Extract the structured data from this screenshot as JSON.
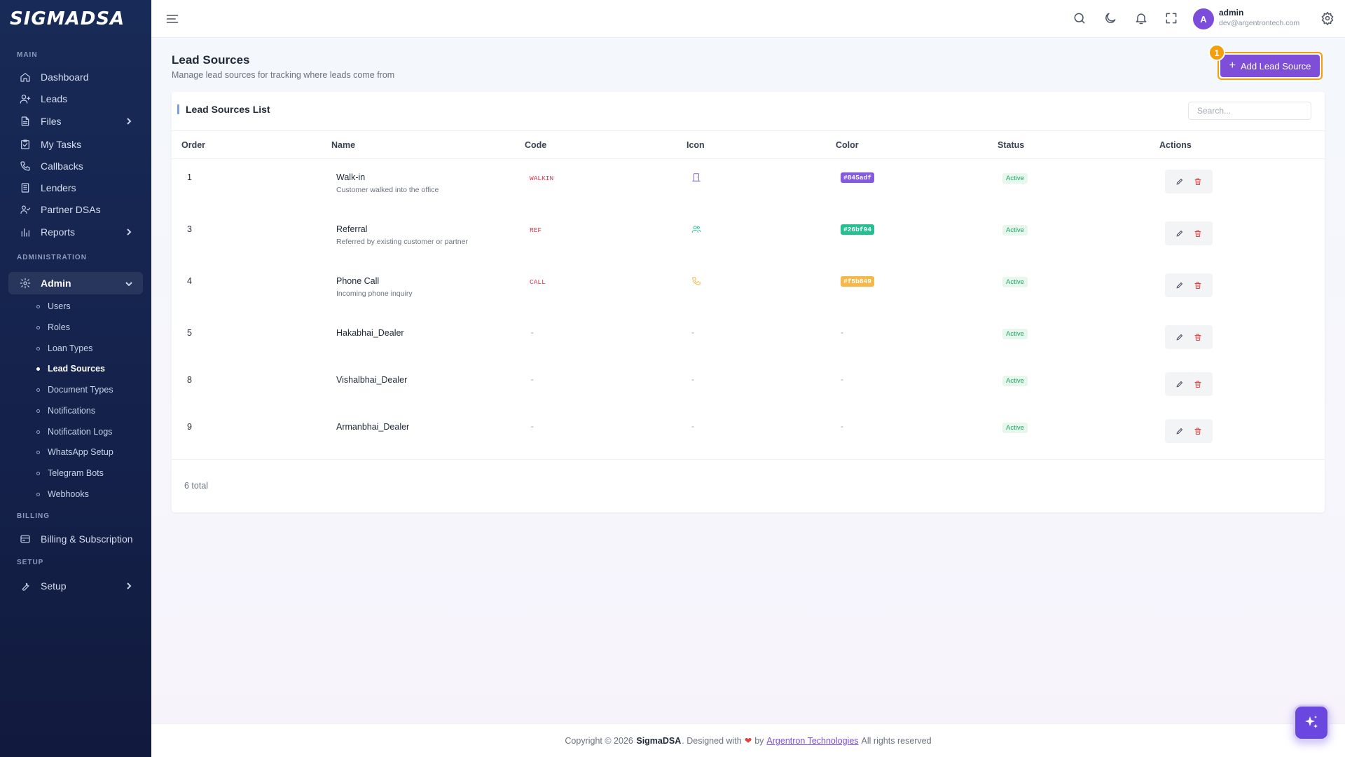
{
  "brand": {
    "logo": "SIGMADSA"
  },
  "sidebar": {
    "sections": {
      "main": "MAIN",
      "administration": "ADMINISTRATION",
      "billing": "BILLING",
      "setup": "SETUP"
    },
    "items": {
      "dashboard": "Dashboard",
      "leads": "Leads",
      "files": "Files",
      "my_tasks": "My Tasks",
      "callbacks": "Callbacks",
      "lenders": "Lenders",
      "partner_dsas": "Partner DSAs",
      "reports": "Reports",
      "admin": "Admin",
      "billing": "Billing & Subscription",
      "setup": "Setup"
    },
    "admin_sub": [
      "Users",
      "Roles",
      "Loan Types",
      "Lead Sources",
      "Document Types",
      "Notifications",
      "Notification Logs",
      "WhatsApp Setup",
      "Telegram Bots",
      "Webhooks"
    ],
    "active_sub": "Lead Sources"
  },
  "user": {
    "avatar_initial": "A",
    "name": "admin",
    "email": "dev@argentrontech.com"
  },
  "page": {
    "title": "Lead Sources",
    "subtitle": "Manage lead sources for tracking where leads come from",
    "add_button": "Add Lead Source",
    "step_badge": "1"
  },
  "card": {
    "title": "Lead Sources List",
    "search_placeholder": "Search...",
    "columns": [
      "Order",
      "Name",
      "Code",
      "Icon",
      "Color",
      "Status",
      "Actions"
    ],
    "rows": [
      {
        "order": "1",
        "name": "Walk-in",
        "description": "Customer walked into the office",
        "code": "WALKIN",
        "icon": "door-icon",
        "color": "#845adf",
        "status": "Active"
      },
      {
        "order": "3",
        "name": "Referral",
        "description": "Referred by existing customer or partner",
        "code": "REF",
        "icon": "users-icon",
        "color": "#26bf94",
        "status": "Active"
      },
      {
        "order": "4",
        "name": "Phone Call",
        "description": "Incoming phone inquiry",
        "code": "CALL",
        "icon": "phone-icon",
        "color": "#f5b849",
        "status": "Active"
      },
      {
        "order": "5",
        "name": "Hakabhai_Dealer",
        "description": "",
        "code": "-",
        "icon": "-",
        "color": "-",
        "status": "Active"
      },
      {
        "order": "8",
        "name": "Vishalbhai_Dealer",
        "description": "",
        "code": "-",
        "icon": "-",
        "color": "-",
        "status": "Active"
      },
      {
        "order": "9",
        "name": "Armanbhai_Dealer",
        "description": "",
        "code": "-",
        "icon": "-",
        "color": "-",
        "status": "Active"
      }
    ],
    "total": "6 total"
  },
  "footer": {
    "copyright": "Copyright © 2026",
    "brand": "SigmaDSA",
    "designed": ". Designed with",
    "by": "by",
    "company": "Argentron Technologies",
    "rights": "All rights reserved"
  },
  "colors": {
    "accent": "#7e4ed9",
    "highlight": "#f59e0b",
    "danger": "#e53e3e",
    "success": "#1fa463"
  }
}
